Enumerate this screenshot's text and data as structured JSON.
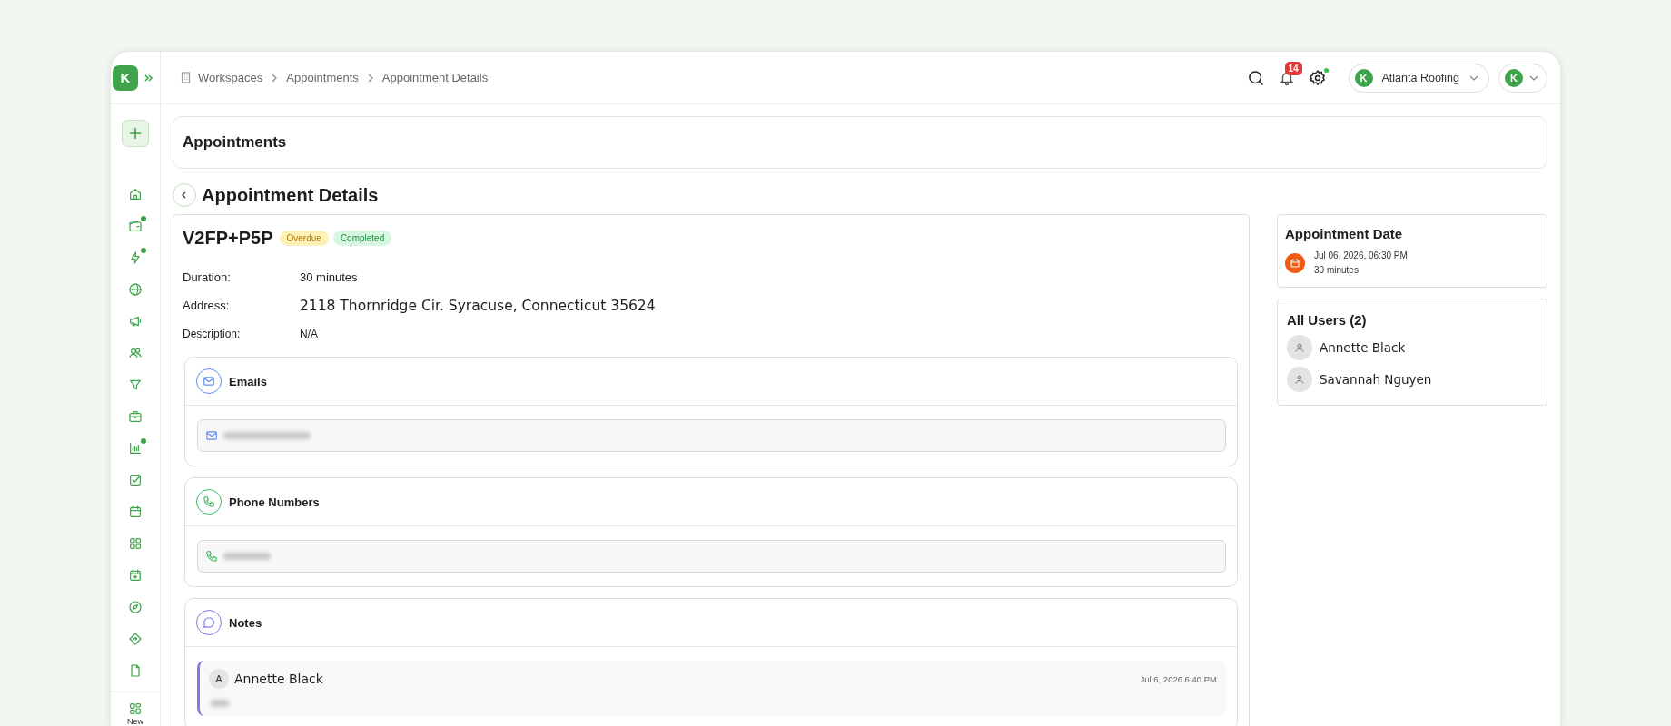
{
  "app": {
    "logo_letter": "K"
  },
  "breadcrumbs": [
    {
      "label": "Workspaces"
    },
    {
      "label": "Appointments"
    },
    {
      "label": "Appointment Details"
    }
  ],
  "topbar": {
    "notification_count": "14",
    "settings_dot": true,
    "workspace": {
      "logo_letter": "K",
      "name": "Atlanta Roofing"
    },
    "profile": {
      "logo_letter": "K"
    }
  },
  "sidebar": {
    "items": [
      {
        "dot": false
      },
      {
        "dot": true
      },
      {
        "dot": true
      },
      {
        "dot": false
      },
      {
        "dot": false
      },
      {
        "dot": false
      },
      {
        "dot": false
      },
      {
        "dot": false
      },
      {
        "dot": true
      },
      {
        "dot": false
      },
      {
        "dot": false
      },
      {
        "dot": false
      },
      {
        "dot": false
      },
      {
        "dot": false
      },
      {
        "dot": false
      },
      {
        "dot": false
      }
    ],
    "new_label": "New"
  },
  "page": {
    "section_title": "Appointments",
    "title": "Appointment Details"
  },
  "appointment": {
    "code": "V2FP+P5P",
    "badges": [
      {
        "label": "Overdue",
        "kind": "warning"
      },
      {
        "label": "Completed",
        "kind": "success"
      }
    ],
    "fields": [
      {
        "label": "Duration:",
        "value": "30 minutes",
        "kind": "plain"
      },
      {
        "label": "Address:",
        "value": "2118 Thornridge Cir. Syracuse, Connecticut 35624",
        "kind": "large"
      },
      {
        "label": "Description:",
        "value": "N/A",
        "kind": "small"
      }
    ],
    "sections": [
      {
        "kind": "email",
        "title": "Emails"
      },
      {
        "kind": "phone",
        "title": "Phone Numbers"
      },
      {
        "kind": "notes",
        "title": "Notes",
        "notes": [
          {
            "initial": "A",
            "author": "Annette Black",
            "time": "Jul 6, 2026 6:40 PM"
          }
        ]
      }
    ]
  },
  "appointment_date": {
    "title": "Appointment Date",
    "datetime": "Jul 06, 2026, 06:30 PM",
    "duration": "30 minutes"
  },
  "users": {
    "title": "All Users (2)",
    "items": [
      {
        "name": "Annette Black"
      },
      {
        "name": "Savannah Nguyen"
      }
    ]
  }
}
